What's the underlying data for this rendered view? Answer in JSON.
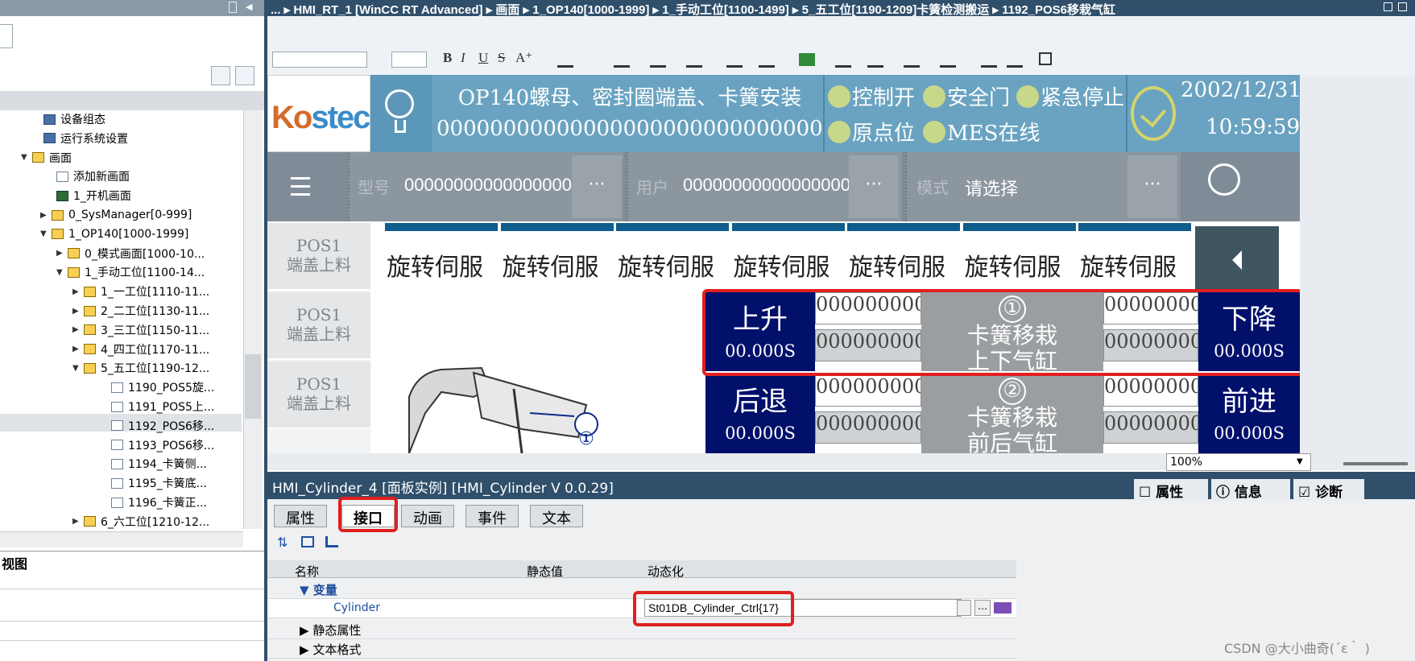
{
  "topbar": {
    "breadcrumb": "... ▸ HMI_RT_1 [WinCC RT Advanced] ▸ 画面 ▸ 1_OP140[1000-1999] ▸ 1_手动工位[1100-1499] ▸ 5_五工位[1190-1209]卡簧检测搬运 ▸ 1192_POS6移栽气缸"
  },
  "tree": {
    "items": [
      {
        "label": "设备组态",
        "arrow": "",
        "icon": "gear"
      },
      {
        "label": "运行系统设置",
        "arrow": "",
        "icon": "gear"
      },
      {
        "label": "画面",
        "arrow": "▼",
        "icon": "folder"
      },
      {
        "label": "添加新画面",
        "arrow": "",
        "icon": "pg"
      },
      {
        "label": "1_开机画面",
        "arrow": "",
        "icon": "scr"
      },
      {
        "label": "0_SysManager[0-999]",
        "arrow": "▶",
        "icon": "folder"
      },
      {
        "label": "1_OP140[1000-1999]",
        "arrow": "▼",
        "icon": "folder"
      },
      {
        "label": "0_模式画面[1000-10...",
        "arrow": "▶",
        "icon": "folder"
      },
      {
        "label": "1_手动工位[1100-14...",
        "arrow": "▼",
        "icon": "folder"
      },
      {
        "label": "1_一工位[1110-11...",
        "arrow": "▶",
        "icon": "folder"
      },
      {
        "label": "2_二工位[1130-11...",
        "arrow": "▶",
        "icon": "folder"
      },
      {
        "label": "3_三工位[1150-11...",
        "arrow": "▶",
        "icon": "folder"
      },
      {
        "label": "4_四工位[1170-11...",
        "arrow": "▶",
        "icon": "folder"
      },
      {
        "label": "5_五工位[1190-12...",
        "arrow": "▼",
        "icon": "folder"
      },
      {
        "label": "1190_POS5旋...",
        "arrow": "",
        "icon": "pg"
      },
      {
        "label": "1191_POS5上...",
        "arrow": "",
        "icon": "pg"
      },
      {
        "label": "1192_POS6移...",
        "arrow": "",
        "icon": "pg"
      },
      {
        "label": "1193_POS6移...",
        "arrow": "",
        "icon": "pg"
      },
      {
        "label": "1194_卡簧侧...",
        "arrow": "",
        "icon": "pg"
      },
      {
        "label": "1195_卡簧底...",
        "arrow": "",
        "icon": "pg"
      },
      {
        "label": "1196_卡簧正...",
        "arrow": "",
        "icon": "pg"
      },
      {
        "label": "6_六工位[1210-12...",
        "arrow": "▶",
        "icon": "folder"
      }
    ],
    "views_label": "视图"
  },
  "toolbar": {
    "bold": "B",
    "italic": "I",
    "underline": "U",
    "strike": "S",
    "font_grow": "A⁺"
  },
  "hmi": {
    "title": "OP140螺母、密封圈端盖、卡簧安装",
    "zeros": "0000000000000000000000000000000000000",
    "ind1": "控制开",
    "ind2": "安全门",
    "ind3": "紧急停止",
    "ind4": "原点位",
    "ind5": "MES在线",
    "date": "2002/12/31",
    "time": "10:59:59",
    "f1_label": "型号",
    "f1_value": "0000000000000000000",
    "f2_label": "用户",
    "f2_value": "0000000000000000000",
    "f3_label": "模式",
    "f3_value": "请选择",
    "more": "···",
    "left_tabs": [
      {
        "line1": "POS1",
        "line2": "端盖上料"
      },
      {
        "line1": "POS1",
        "line2": "端盖上料"
      },
      {
        "line1": "POS1",
        "line2": "端盖上料"
      }
    ],
    "servo_tab": "旋转伺服",
    "cyl": [
      {
        "up": "上升",
        "up_time": "00.000S",
        "down": "下降",
        "down_time": "00.000S",
        "num": "①",
        "name1": "卡簧移栽",
        "name2": "上下气缸"
      },
      {
        "up": "后退",
        "up_time": "00.000S",
        "down": "前进",
        "down_time": "00.000S",
        "num": "②",
        "name1": "卡簧移栽",
        "name2": "前后气缸"
      }
    ],
    "zf": "0000000000000",
    "machine_marker": "①"
  },
  "zoom": "100%",
  "props": {
    "title": "HMI_Cylinder_4 [面板实例] [HMI_Cylinder V 0.0.29]",
    "right_tabs": {
      "p": "属性",
      "i": "信息",
      "d": "诊断"
    },
    "tabs": [
      "属性",
      "接口",
      "动画",
      "事件",
      "文本"
    ],
    "col_name": "名称",
    "col_static": "静态值",
    "col_dyn": "动态化",
    "rows": {
      "vars": "变量",
      "cyl_name": "Cylinder",
      "cyl_dyn": "St01DB_Cylinder_Ctrl{17}",
      "static_props": "静态属性",
      "text_fmt": "文本格式"
    }
  },
  "watermark": "CSDN @大小曲奇(´ε｀ )"
}
